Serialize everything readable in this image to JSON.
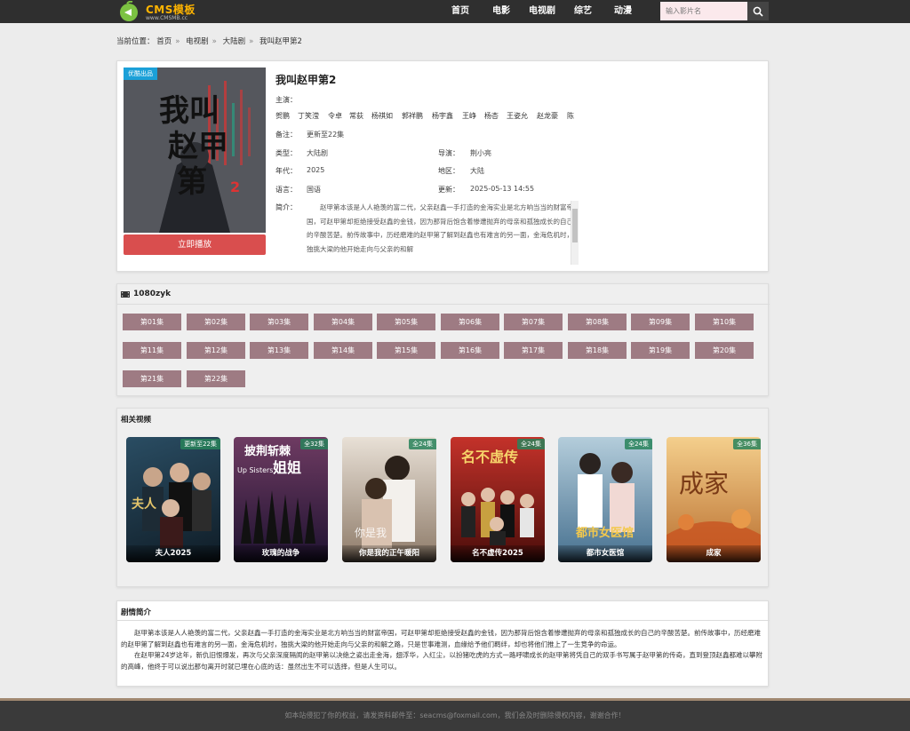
{
  "header": {
    "logo_text": "CMS模板",
    "logo_sub": "www.CMSMB.cc",
    "nav": [
      "首页",
      "电影",
      "电视剧",
      "综艺",
      "动漫"
    ],
    "search_placeholder": "输入影片名"
  },
  "breadcrumb": {
    "prefix": "当前位置：",
    "items": [
      "首页",
      "电视剧",
      "大陆剧",
      "我叫赵甲第2"
    ]
  },
  "detail": {
    "poster_tag": "优酷出品",
    "title": "我叫赵甲第2",
    "play_label": "立即播放",
    "actors_label": "主演：",
    "actors": [
      "贺鹏",
      "丁笑滢",
      "令卓",
      "常荻",
      "杨祺如",
      "郭祥鹏",
      "杨宇鑫",
      "王峥",
      "杨杏",
      "王姿允",
      "赵龙豪",
      "陈"
    ],
    "remark_label": "备注：",
    "remark": "更新至22集",
    "type_label": "类型：",
    "type": "大陆剧",
    "director_label": "导演：",
    "director": "荆小亮",
    "year_label": "年代：",
    "year": "2025",
    "area_label": "地区：",
    "area": "大陆",
    "lang_label": "语言：",
    "lang": "国语",
    "update_label": "更新：",
    "update": "2025-05-13 14:55",
    "intro_label": "简介：",
    "intro": "赵甲第本该是人人艳羡的富二代，父亲赵鑫一手打造的金海实业是北方响当当的财富帝国，可赵甲第却拒绝接受赵鑫的金钱，因为那背后饱含着惨遭抛弃的母亲和孤独成长的自己的辛酸苦楚。前传故事中，历经磨难的赵甲第了解到赵鑫也有难言的另一面，金海危机时，独挑大梁的他开始走向与父亲的和解"
  },
  "episodes": {
    "source": "1080zyk",
    "list": [
      "第01集",
      "第02集",
      "第03集",
      "第04集",
      "第05集",
      "第06集",
      "第07集",
      "第08集",
      "第09集",
      "第10集",
      "第11集",
      "第12集",
      "第13集",
      "第14集",
      "第15集",
      "第16集",
      "第17集",
      "第18集",
      "第19集",
      "第20集",
      "第21集",
      "第22集"
    ]
  },
  "related": {
    "title": "相关视频",
    "items": [
      {
        "name": "夫人2025",
        "badge": "更新至22集",
        "color1": "#2a4d63",
        "color2": "#0f1c26"
      },
      {
        "name": "玫瑰的战争",
        "badge": "全32集",
        "color1": "#6e3b62",
        "color2": "#1e1230"
      },
      {
        "name": "你是我的正午暖阳",
        "badge": "全24集",
        "color1": "#d8cfc4",
        "color2": "#7d6a5a"
      },
      {
        "name": "名不虚传2025",
        "badge": "全24集",
        "color1": "#b22a22",
        "color2": "#4a0d0a"
      },
      {
        "name": "都市女医馆",
        "badge": "全24集",
        "color1": "#a7c3d4",
        "color2": "#3f6d8f"
      },
      {
        "name": "成家",
        "badge": "全36集",
        "color1": "#f1c27a",
        "color2": "#b76a2b"
      }
    ]
  },
  "synopsis": {
    "title": "剧情简介",
    "p1": "赵甲第本该是人人艳羡的富二代，父亲赵鑫一手打造的金海实业是北方响当当的财富帝国，可赵甲第却拒绝接受赵鑫的金钱，因为那背后饱含着惨遭抛弃的母亲和孤独成长的自己的辛酸苦楚。前传故事中，历经磨难的赵甲第了解到赵鑫也有难言的另一面，金海危机时，独挑大梁的他开始走向与父亲的和解之路，只是世事难测，血缘给予他们羁绊，却也将他们推上了一生竞争的命运。",
    "p2": "在赵甲第24岁这年，新仇旧恨爆发，再次与父亲深度隔阂的赵甲第以决绝之姿出走金海，翅浮华，入红尘，以扮猪吃虎的方式一路呼啸成长的赵甲第将凭自己的双手书写属于赵甲第的传奇，直到登顶赵鑫都难以攀附的高峰，他终于可以说出那句离开时就已埋在心底的话：虽然出生不可以选择，但是人生可以。"
  },
  "footer": {
    "text": "如本站侵犯了你的权益，请发资料邮件至：seacms@foxmail.com，我们会及时删除侵权内容，谢谢合作！"
  }
}
